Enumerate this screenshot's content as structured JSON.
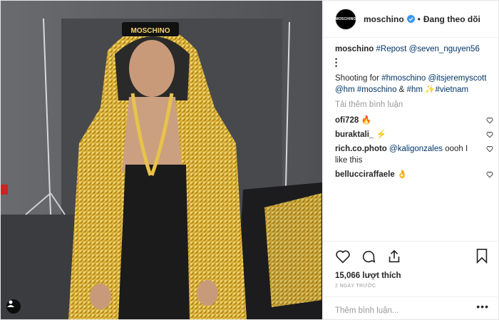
{
  "colors": {
    "link": "#003569",
    "muted": "#999999",
    "text": "#262626",
    "verified": "#3897f0",
    "gold": "#c9a227"
  },
  "post": {
    "photo": {
      "hat_text": "MOSCHINO"
    },
    "header": {
      "avatar_text": "MOSCHINO",
      "username": "moschino",
      "dot": "•",
      "follow_label": "Đang theo dõi"
    },
    "caption": {
      "user": "moschino",
      "line1_parts": [
        "#Repost",
        "@seven_nguyen56"
      ],
      "ellipsis": "•\n•\n•",
      "prefix": "Shooting for ",
      "tag_hm": "#hmoschino",
      "mention": "@itsjeremyscott",
      "tag2": "@hm",
      "tag3": "#moschino",
      "amp": " & ",
      "tag4": "#hm",
      "sparkle": "✨",
      "tag5": "#vietnam"
    },
    "load_more": "Tải thêm bình luận",
    "comments": [
      {
        "user": "ofi728",
        "text": "🔥"
      },
      {
        "user": "buraktali_",
        "text": "⚡"
      },
      {
        "user": "rich.co.photo",
        "mention": "@kaligonzales",
        "text": " oooh I like this"
      },
      {
        "user": "bellucciraffaele",
        "text": "👌"
      }
    ],
    "likes": "15,066 lượt thích",
    "time": "2 NGÀY TRƯỚC",
    "add_comment_placeholder": "Thêm bình luận...",
    "more": "•••"
  }
}
